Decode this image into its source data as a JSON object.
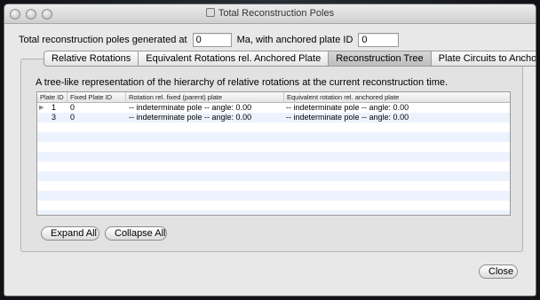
{
  "window": {
    "title": "Total Reconstruction Poles"
  },
  "header": {
    "label_prefix": "Total reconstruction poles generated at",
    "time_value": "0",
    "label_middle": "Ma, with anchored plate ID",
    "plate_value": "0"
  },
  "tabs": [
    {
      "label": "Relative Rotations",
      "active": false
    },
    {
      "label": "Equivalent Rotations rel. Anchored Plate",
      "active": false
    },
    {
      "label": "Reconstruction Tree",
      "active": true
    },
    {
      "label": "Plate Circuits to Anchored Plate",
      "active": false
    }
  ],
  "panel": {
    "description": "A tree-like representation of the hierarchy of relative rotations at the current reconstruction time."
  },
  "tree": {
    "columns": [
      "Plate ID",
      "Fixed Plate ID",
      "Rotation rel. fixed (parent) plate",
      "Equivalent rotation rel. anchored plate"
    ],
    "rows": [
      {
        "expander": "▶",
        "plate_id": "1",
        "fixed_plate_id": "0",
        "rotation": "-- indeterminate pole --   angle: 0.00",
        "equivalent": "-- indeterminate pole --   angle: 0.00"
      },
      {
        "expander": "",
        "plate_id": "3",
        "fixed_plate_id": "0",
        "rotation": "-- indeterminate pole --   angle: 0.00",
        "equivalent": "-- indeterminate pole --   angle: 0.00"
      }
    ]
  },
  "buttons": {
    "expand_all": "Expand All",
    "collapse_all": "Collapse All",
    "close": "Close"
  },
  "colors": {
    "stripe": "#edf3fe",
    "active_tab": "#c8c8c8"
  },
  "icons": {
    "title_icon": "window-icon",
    "expander": "disclosure-triangle-icon"
  }
}
